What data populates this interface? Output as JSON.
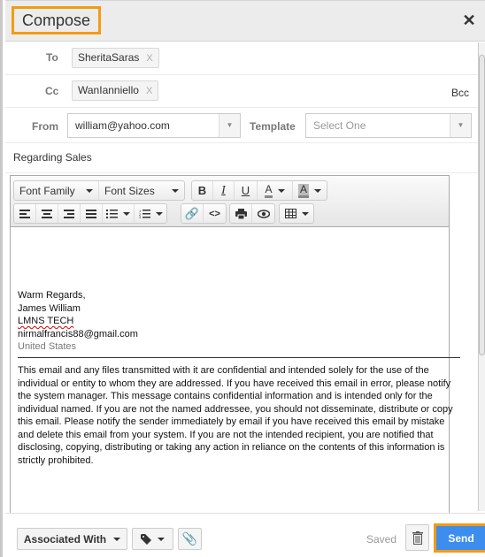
{
  "header": {
    "title": "Compose",
    "close_icon": "close-icon"
  },
  "to": {
    "label": "To",
    "recipients": [
      {
        "name": "SheritaSaras",
        "remove": "X"
      }
    ]
  },
  "cc": {
    "label": "Cc",
    "recipients": [
      {
        "name": "WanIanniello",
        "remove": "X"
      }
    ],
    "bcc_label": "Bcc"
  },
  "from": {
    "label": "From",
    "value": "william@yahoo.com"
  },
  "template": {
    "label": "Template",
    "placeholder": "Select One"
  },
  "subject": "Regarding Sales",
  "toolbar": {
    "font_family": "Font Family",
    "font_sizes": "Font Sizes",
    "bold": "B",
    "italic": "I",
    "underline": "U",
    "text_color": "A",
    "bg_color": "A"
  },
  "body": {
    "signature": {
      "closing": "Warm Regards,",
      "name": "James William",
      "company": "LMNS TECH",
      "email": "nirmalfrancis88@gmail.com",
      "country": "United States"
    },
    "disclaimer": "This email and any files transmitted with it are confidential and intended solely for the use of the individual or entity to whom they are addressed. If you have received this email in error, please notify the system manager. This message contains confidential information and is intended only for the individual named. If you are not the named addressee, you should not disseminate, distribute or copy this email. Please notify the sender immediately by email if you have received this email by mistake and delete this email from your system. If you are not the intended recipient, you are notified that disclosing, copying, distributing or taking any action in reliance on the contents of this information is strictly prohibited."
  },
  "footer": {
    "associated_with": "Associated With",
    "status": "Saved",
    "send": "Send"
  },
  "colors": {
    "highlight": "#f39c12",
    "send_button": "#3c8dee"
  }
}
